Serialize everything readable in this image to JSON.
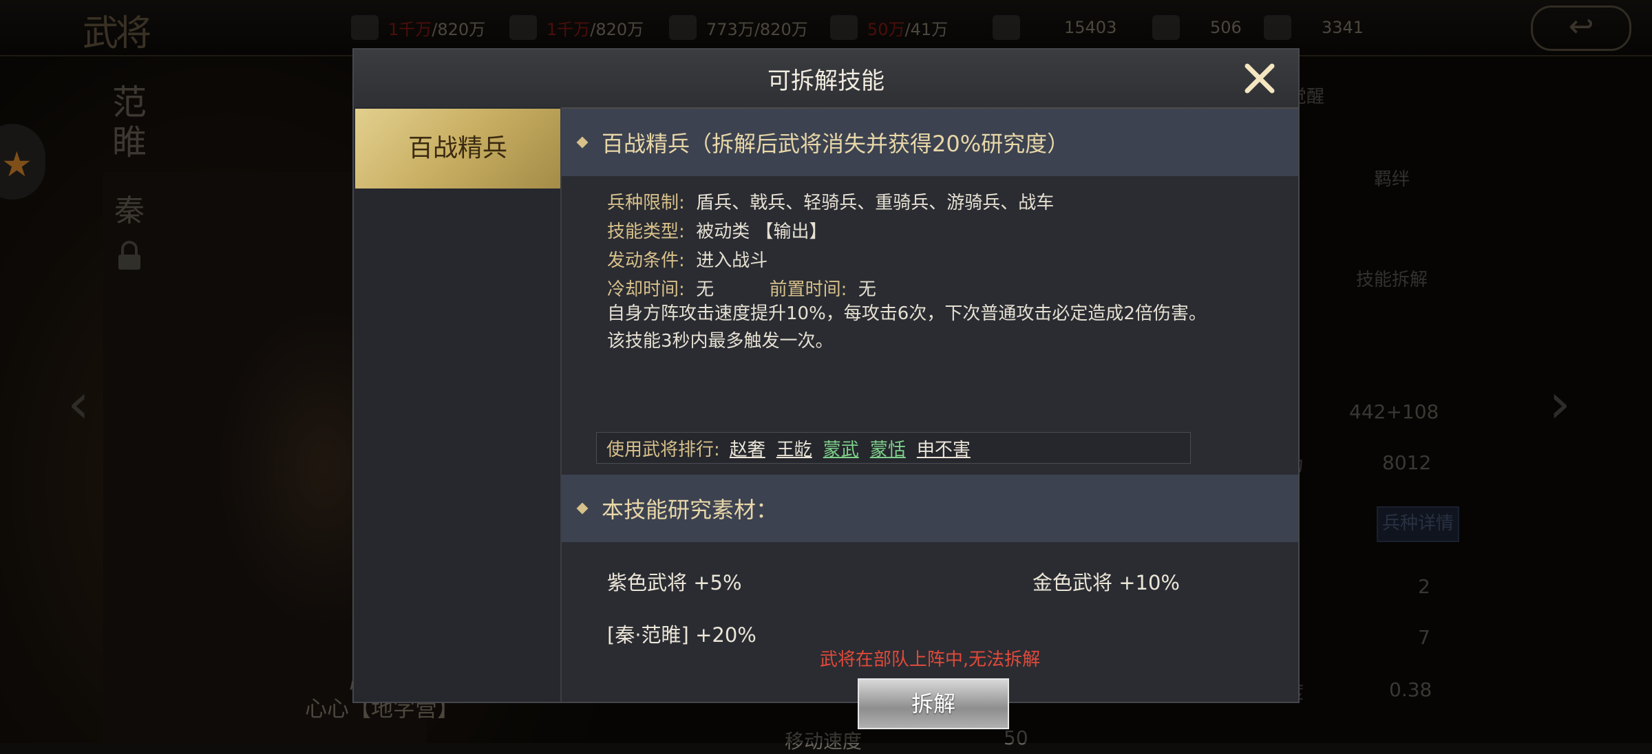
{
  "top_bar": {
    "title_mark": "武将",
    "resources": [
      {
        "icon": "grain-icon",
        "current": "1千万",
        "max": "/820万",
        "current_red": true
      },
      {
        "icon": "wood-icon",
        "current": "1千万",
        "max": "/820万",
        "current_red": true
      },
      {
        "icon": "stone-icon",
        "current": "773万",
        "max": "/820万",
        "current_red": false
      },
      {
        "icon": "iron-icon",
        "current": "50万",
        "max": "/41万",
        "current_red": true
      },
      {
        "icon": "token-icon",
        "current": "15403",
        "max": "",
        "current_red": false
      },
      {
        "icon": "silver-ingot-icon",
        "current": "506",
        "max": "",
        "current_red": false
      },
      {
        "icon": "gold-ingot-icon",
        "current": "3341",
        "max": "",
        "current_red": false
      }
    ],
    "back_label": "↩"
  },
  "background": {
    "general_name": "范\n睢",
    "faction": "秦",
    "portrait_caption_line1": "心心一",
    "portrait_caption_line2": "心心【地字营】",
    "side": {
      "reminder_label": "觉醒",
      "bond_label": "羁绊",
      "dismantle_label": "技能拆解",
      "stat_1": "442+108",
      "stat_2_label": "力",
      "stat_2": "8012",
      "troop_detail": "兵种详情",
      "stat_3": "2",
      "stat_4": "7",
      "stat_5_label": "度",
      "stat_5": "0.38",
      "move_label": "移动速度",
      "move_val": "50"
    }
  },
  "modal": {
    "title": "可拆解技能",
    "tab_active": "百战精兵",
    "skill_header": "百战精兵（拆解后武将消失并获得20%研究度）",
    "troop_limit_label": "兵种限制:",
    "troop_limit": "盾兵、戟兵、轻骑兵、重骑兵、游骑兵、战车",
    "skill_type_label": "技能类型:",
    "skill_type": "被动类 【输出】",
    "trigger_label": "发动条件:",
    "trigger": "进入战斗",
    "cooldown_label": "冷却时间:",
    "cooldown": "无",
    "precast_label": "前置时间:",
    "precast": "无",
    "desc_line1": "自身方阵攻击速度提升10%，每攻击6次，下次普通攻击必定造成2倍伤害。",
    "desc_line2": "该技能3秒内最多触发一次。",
    "users_label": "使用武将排行:",
    "users": [
      {
        "name": "赵奢",
        "color": "white"
      },
      {
        "name": "王龁",
        "color": "white"
      },
      {
        "name": "蒙武",
        "color": "green"
      },
      {
        "name": "蒙恬",
        "color": "green"
      },
      {
        "name": "申不害",
        "color": "white"
      }
    ],
    "materials_header": "本技能研究素材：",
    "material_purple": "紫色武将 +5%",
    "material_gold": "金色武将 +10%",
    "material_specific": "[秦·范睢] +20%",
    "warning": "武将在部队上阵中,无法拆解",
    "dismantle_button": "拆解"
  }
}
